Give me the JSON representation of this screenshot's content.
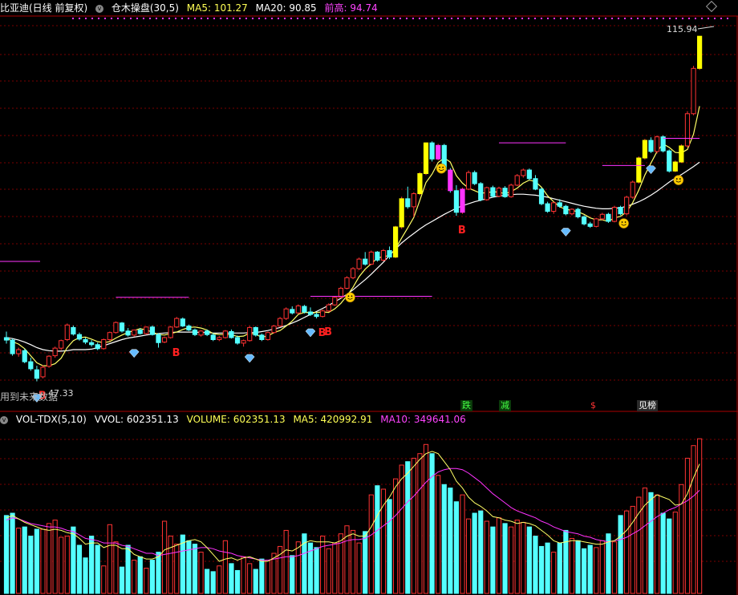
{
  "main_header": {
    "stock": "比亚迪(日线 前复权)",
    "indicator": "仓木操盘(30,5)",
    "ma5": "MA5: 101.27",
    "ma20": "MA20: 90.85",
    "prev_high": "前高: 94.74"
  },
  "vol_header": {
    "name": "VOL-TDX(5,10)",
    "vvol": "VVOL: 602351.13",
    "volume": "VOLUME: 602351.13",
    "ma5": "MA5: 420992.91",
    "ma10": "MA10: 349641.06"
  },
  "labels": {
    "max_price": "115.94",
    "min_price": "47.33",
    "future_note": "用到未来数据",
    "signals": [
      "跌",
      "减",
      "$",
      "见榜"
    ]
  },
  "colors": {
    "up": "#ff3333",
    "down": "#54ffff",
    "ma_short": "#ffff66",
    "ma_long": "#ffffff",
    "magenta": "#ff33ff",
    "grid": "#7a0000",
    "yellow_bar": "#ffff00",
    "buy_marker": "#ff2020",
    "diamond": "#66bbff",
    "smile": "#ffcc00",
    "header_white": "#ffffff",
    "header_yellow": "#ffff55",
    "header_magenta": "#ff44ff"
  },
  "chart_data": [
    {
      "type": "candlestick",
      "title": "比亚迪(日线 前复权)",
      "candles": [
        [
          56.0,
          57.2,
          54.8,
          55.5
        ],
        [
          55.5,
          55.8,
          52.4,
          52.8
        ],
        [
          52.8,
          54.0,
          52.2,
          53.6
        ],
        [
          53.4,
          53.8,
          50.9,
          51.2
        ],
        [
          51.2,
          52.0,
          49.4,
          49.8
        ],
        [
          49.6,
          50.4,
          47.3,
          47.9
        ],
        [
          48.2,
          50.5,
          47.9,
          50.1
        ],
        [
          50.3,
          52.5,
          50.0,
          52.3
        ],
        [
          52.4,
          54.2,
          52.0,
          53.9
        ],
        [
          53.9,
          55.6,
          53.5,
          55.4
        ],
        [
          55.6,
          58.8,
          55.3,
          58.5
        ],
        [
          58.0,
          58.4,
          56.4,
          56.7
        ],
        [
          56.6,
          57.0,
          55.4,
          55.7
        ],
        [
          55.6,
          56.0,
          54.7,
          55.1
        ],
        [
          55.0,
          55.5,
          54.2,
          54.6
        ],
        [
          54.6,
          55.0,
          53.5,
          53.8
        ],
        [
          53.8,
          55.8,
          53.6,
          55.6
        ],
        [
          55.6,
          57.2,
          55.3,
          57.0
        ],
        [
          57.0,
          59.2,
          56.8,
          59.0
        ],
        [
          58.9,
          59.1,
          57.0,
          57.3
        ],
        [
          57.3,
          57.9,
          56.2,
          56.5
        ],
        [
          56.5,
          57.6,
          56.2,
          57.5
        ],
        [
          57.5,
          57.9,
          56.6,
          56.8
        ],
        [
          56.8,
          58.2,
          56.6,
          58.1
        ],
        [
          58.1,
          58.4,
          56.4,
          56.6
        ],
        [
          56.6,
          56.9,
          54.0,
          55.0
        ],
        [
          55.1,
          56.2,
          54.9,
          56.0
        ],
        [
          56.0,
          58.3,
          55.8,
          58.1
        ],
        [
          58.1,
          60.1,
          57.9,
          59.8
        ],
        [
          59.7,
          60.0,
          58.1,
          58.3
        ],
        [
          58.3,
          58.6,
          57.3,
          57.5
        ],
        [
          57.5,
          57.8,
          56.3,
          56.6
        ],
        [
          56.5,
          57.5,
          56.2,
          57.3
        ],
        [
          57.3,
          57.6,
          56.3,
          56.6
        ],
        [
          56.5,
          56.9,
          55.3,
          55.6
        ],
        [
          55.6,
          56.3,
          55.3,
          56.0
        ],
        [
          56.0,
          57.5,
          55.8,
          57.3
        ],
        [
          57.2,
          57.6,
          55.8,
          56.0
        ],
        [
          56.0,
          56.4,
          54.6,
          54.9
        ],
        [
          54.9,
          55.6,
          54.2,
          55.4
        ],
        [
          55.4,
          58.3,
          55.2,
          58.0
        ],
        [
          58.0,
          58.2,
          56.2,
          56.5
        ],
        [
          56.5,
          56.8,
          55.3,
          55.6
        ],
        [
          55.6,
          57.2,
          55.4,
          57.0
        ],
        [
          57.0,
          58.5,
          56.8,
          58.3
        ],
        [
          58.3,
          60.1,
          58.1,
          59.8
        ],
        [
          59.8,
          62.0,
          59.5,
          61.7
        ],
        [
          61.6,
          62.2,
          60.6,
          60.9
        ],
        [
          60.9,
          62.6,
          60.7,
          62.3
        ],
        [
          62.2,
          62.5,
          60.8,
          61.1
        ],
        [
          61.1,
          62.0,
          60.3,
          60.6
        ],
        [
          60.6,
          61.0,
          59.8,
          60.2
        ],
        [
          60.2,
          61.6,
          60.0,
          61.3
        ],
        [
          61.3,
          62.8,
          61.1,
          62.5
        ],
        [
          62.5,
          64.2,
          62.3,
          64.0
        ],
        [
          64.0,
          66.1,
          63.8,
          65.8
        ],
        [
          65.8,
          68.2,
          65.6,
          67.9
        ],
        [
          67.9,
          70.0,
          67.6,
          69.7
        ],
        [
          69.7,
          71.9,
          69.4,
          71.6
        ],
        [
          71.6,
          73.0,
          70.3,
          70.6
        ],
        [
          70.6,
          73.3,
          70.4,
          73.0
        ],
        [
          73.0,
          73.2,
          71.1,
          71.4
        ],
        [
          71.4,
          73.6,
          71.2,
          73.3
        ],
        [
          73.3,
          74.1,
          71.6,
          72.0
        ],
        [
          72.0,
          78.2,
          71.8,
          78.0
        ],
        [
          78.0,
          84.0,
          77.6,
          83.6
        ],
        [
          83.6,
          86.0,
          81.6,
          82.0
        ],
        [
          82.0,
          84.9,
          80.0,
          84.6
        ],
        [
          84.6,
          88.9,
          84.3,
          88.6
        ],
        [
          88.6,
          94.8,
          88.3,
          94.7
        ],
        [
          94.7,
          95.0,
          91.0,
          91.5
        ],
        [
          91.5,
          94.5,
          91.2,
          94.2
        ],
        [
          94.2,
          94.5,
          88.8,
          89.3
        ],
        [
          89.3,
          89.7,
          84.8,
          85.2
        ],
        [
          85.2,
          86.3,
          80.2,
          80.9
        ],
        [
          80.9,
          85.8,
          80.6,
          85.5
        ],
        [
          85.5,
          89.2,
          85.3,
          88.8
        ],
        [
          88.8,
          89.2,
          86.3,
          86.6
        ],
        [
          86.6,
          86.9,
          83.1,
          83.4
        ],
        [
          83.4,
          86.0,
          83.2,
          85.8
        ],
        [
          85.8,
          86.2,
          83.8,
          84.1
        ],
        [
          84.1,
          86.0,
          83.9,
          85.7
        ],
        [
          85.7,
          86.1,
          83.8,
          84.0
        ],
        [
          84.0,
          86.6,
          83.8,
          86.3
        ],
        [
          86.3,
          88.5,
          86.1,
          88.2
        ],
        [
          88.2,
          89.6,
          87.8,
          89.3
        ],
        [
          89.3,
          89.6,
          87.3,
          87.6
        ],
        [
          87.6,
          88.3,
          85.3,
          85.5
        ],
        [
          85.5,
          85.8,
          82.3,
          82.6
        ],
        [
          82.6,
          83.0,
          80.8,
          81.1
        ],
        [
          81.1,
          83.0,
          80.6,
          82.8
        ],
        [
          82.8,
          83.5,
          81.8,
          82.1
        ],
        [
          82.1,
          82.4,
          80.3,
          80.6
        ],
        [
          80.6,
          81.7,
          80.3,
          81.5
        ],
        [
          81.5,
          81.8,
          79.7,
          80.0
        ],
        [
          80.0,
          80.3,
          78.3,
          78.6
        ],
        [
          78.6,
          79.0,
          77.8,
          78.1
        ],
        [
          78.1,
          79.8,
          77.9,
          79.6
        ],
        [
          79.6,
          80.8,
          79.3,
          80.5
        ],
        [
          80.5,
          80.8,
          78.8,
          79.1
        ],
        [
          79.1,
          82.2,
          78.9,
          81.9
        ],
        [
          81.9,
          82.2,
          80.3,
          80.6
        ],
        [
          80.6,
          84.2,
          80.3,
          83.9
        ],
        [
          83.9,
          87.2,
          83.6,
          86.9
        ],
        [
          86.9,
          92.0,
          86.6,
          91.7
        ],
        [
          91.7,
          95.5,
          91.4,
          95.2
        ],
        [
          95.2,
          95.8,
          92.7,
          93.0
        ],
        [
          93.0,
          96.2,
          92.6,
          95.9
        ],
        [
          95.9,
          96.2,
          92.8,
          93.1
        ],
        [
          93.1,
          93.4,
          88.8,
          89.1
        ],
        [
          89.1,
          91.2,
          88.9,
          90.9
        ],
        [
          90.9,
          94.4,
          90.7,
          94.1
        ],
        [
          94.1,
          101.0,
          93.8,
          100.5
        ],
        [
          100.5,
          110.0,
          100.2,
          109.5
        ],
        [
          109.5,
          115.94,
          109.2,
          115.9
        ]
      ],
      "ma5": [
        56.0,
        55.2,
        54.7,
        53.8,
        52.4,
        51.0,
        50.4,
        50.4,
        50.8,
        51.9,
        54.0,
        55.4,
        56.0,
        56.1,
        55.7,
        55.2,
        55.0,
        55.2,
        55.9,
        56.5,
        57.0,
        57.4,
        57.8,
        57.5,
        57.1,
        56.6,
        56.5,
        56.8,
        57.1,
        57.6,
        58.0,
        58.1,
        57.9,
        57.5,
        56.8,
        56.6,
        56.6,
        56.6,
        56.2,
        56.3,
        56.9,
        56.6,
        56.1,
        56.3,
        57.0,
        57.4,
        58.3,
        59.3,
        60.6,
        61.0,
        61.0,
        61.0,
        61.1,
        61.0,
        61.7,
        62.8,
        64.3,
        66.0,
        68.1,
        69.6,
        70.7,
        71.8,
        72.1,
        72.3,
        73.6,
        75.8,
        77.8,
        79.9,
        83.3,
        86.8,
        88.5,
        90.8,
        91.7,
        90.9,
        88.2,
        86.7,
        85.7,
        85.2,
        84.7,
        84.8,
        85.0,
        84.9,
        84.6,
        85.0,
        85.7,
        86.7,
        87.3,
        87.0,
        85.9,
        84.2,
        83.0,
        82.0,
        81.5,
        81.3,
        81.0,
        80.5,
        79.8,
        79.4,
        79.4,
        79.1,
        79.8,
        80.1,
        81.0,
        82.8,
        85.3,
        88.3,
        90.7,
        93.0,
        94.5,
        93.8,
        92.8,
        92.7,
        93.4,
        96.4,
        102.0
      ],
      "ma20": [
        56.0,
        55.8,
        55.5,
        55.1,
        54.6,
        54.0,
        53.6,
        53.4,
        53.3,
        53.3,
        53.4,
        53.6,
        53.6,
        53.6,
        53.7,
        54.0,
        54.4,
        54.8,
        55.2,
        55.6,
        55.9,
        56.1,
        56.3,
        56.5,
        56.7,
        56.8,
        56.9,
        57.0,
        57.1,
        57.1,
        57.1,
        57.1,
        57.0,
        57.0,
        56.9,
        56.9,
        56.9,
        56.9,
        56.9,
        56.9,
        57.0,
        57.0,
        57.2,
        57.4,
        57.7,
        58.0,
        58.4,
        58.9,
        59.4,
        60.0,
        60.6,
        61.2,
        61.8,
        62.4,
        63.1,
        63.8,
        64.6,
        65.5,
        66.5,
        67.5,
        68.6,
        69.8,
        71.0,
        72.3,
        73.6,
        74.8,
        75.8,
        76.7,
        77.6,
        78.4,
        79.1,
        79.8,
        80.5,
        81.1,
        81.7,
        82.2,
        82.6,
        83.0,
        83.3,
        83.6,
        83.9,
        84.1,
        84.3,
        84.4,
        84.5,
        84.5,
        84.4,
        84.3,
        84.1,
        83.9,
        83.6,
        83.3,
        83.0,
        82.7,
        82.4,
        82.1,
        81.9,
        81.7,
        81.6,
        81.6,
        81.7,
        81.8,
        82.1,
        82.5,
        83.0,
        83.6,
        84.3,
        85.1,
        86.0,
        86.9,
        87.7,
        88.4,
        89.2,
        90.0,
        90.85
      ],
      "resistance_segments": [
        {
          "from": 18,
          "to": 30,
          "price": 64.0
        },
        {
          "from": 50,
          "to": 70,
          "price": 64.2
        },
        {
          "from": 81,
          "to": 92,
          "price": 94.7
        },
        {
          "from": 98,
          "to": 105,
          "price": 90.2
        },
        {
          "from": 108,
          "to": 114,
          "price": 95.6
        }
      ],
      "yellow_bars": [
        64,
        65,
        68,
        69,
        104,
        105,
        110,
        111,
        114
      ],
      "magenta_bars": [
        71,
        73,
        75
      ],
      "buy_signals": [
        5,
        27,
        51,
        52,
        74
      ],
      "diamond_signals": [
        5,
        21,
        40,
        50,
        92,
        106
      ],
      "smile_signals": [
        56,
        71,
        101,
        110
      ],
      "last_ma5": 101.27,
      "last_ma20": 90.85,
      "prev_high": 94.74,
      "max_price": 115.94,
      "min_price": 47.33
    },
    {
      "type": "bar",
      "title": "VOL-TDX(5,10)",
      "volumes": [
        68,
        70,
        57,
        58,
        50,
        56,
        56,
        61,
        64,
        49,
        50,
        58,
        42,
        31,
        50,
        42,
        24,
        60,
        45,
        23,
        42,
        29,
        32,
        22,
        29,
        36,
        63,
        50,
        43,
        51,
        46,
        43,
        36,
        21,
        19,
        24,
        46,
        26,
        20,
        32,
        26,
        21,
        30,
        29,
        35,
        41,
        55,
        33,
        45,
        52,
        44,
        40,
        50,
        39,
        44,
        52,
        59,
        55,
        44,
        54,
        86,
        94,
        91,
        82,
        100,
        112,
        115,
        118,
        122,
        130,
        122,
        103,
        95,
        92,
        80,
        86,
        65,
        70,
        72,
        63,
        58,
        66,
        61,
        58,
        64,
        62,
        58,
        50,
        41,
        44,
        36,
        44,
        55,
        48,
        46,
        39,
        42,
        40,
        46,
        52,
        45,
        68,
        72,
        76,
        84,
        92,
        88,
        86,
        70,
        65,
        71,
        95,
        118,
        129,
        135
      ],
      "ma5": [
        66,
        68,
        65,
        62,
        60,
        58,
        56,
        55,
        56,
        55,
        53,
        52,
        48,
        43,
        44,
        44,
        40,
        42,
        42,
        39,
        39,
        34,
        32,
        30,
        30,
        32,
        38,
        40,
        42,
        44,
        46,
        47,
        45,
        40,
        34,
        28,
        30,
        31,
        29,
        31,
        32,
        30,
        28,
        28,
        31,
        34,
        38,
        37,
        40,
        44,
        46,
        45,
        45,
        45,
        44,
        46,
        50,
        52,
        50,
        50,
        58,
        68,
        77,
        84,
        93,
        100,
        105,
        111,
        117,
        122,
        124,
        122,
        115,
        108,
        98,
        92,
        84,
        79,
        76,
        72,
        67,
        66,
        64,
        63,
        61,
        62,
        61,
        59,
        55,
        51,
        46,
        44,
        45,
        46,
        46,
        45,
        44,
        43,
        43,
        45,
        46,
        50,
        55,
        62,
        70,
        77,
        82,
        86,
        84,
        82,
        77,
        78,
        87,
        101,
        113
      ],
      "ma10": [
        64,
        66,
        65,
        63,
        61,
        60,
        59,
        58,
        58,
        57,
        55,
        54,
        51,
        48,
        47,
        46,
        44,
        44,
        44,
        42,
        41,
        39,
        37,
        35,
        35,
        33,
        34,
        35,
        36,
        37,
        38,
        39,
        40,
        40,
        39,
        37,
        36,
        35,
        33,
        32,
        31,
        30,
        29,
        29,
        30,
        31,
        32,
        32,
        33,
        35,
        37,
        39,
        41,
        42,
        43,
        44,
        46,
        47,
        47,
        48,
        51,
        55,
        59,
        63,
        68,
        74,
        80,
        85,
        91,
        97,
        102,
        106,
        108,
        109,
        109,
        108,
        105,
        101,
        97,
        92,
        87,
        83,
        79,
        75,
        72,
        70,
        68,
        66,
        63,
        61,
        58,
        56,
        54,
        53,
        52,
        50,
        49,
        47,
        46,
        45,
        46,
        47,
        49,
        52,
        55,
        59,
        63,
        67,
        70,
        73,
        75,
        78,
        81,
        85,
        90
      ],
      "last_volume": 602351.13,
      "last_ma5": 420992.91,
      "last_ma10": 349641.06
    }
  ]
}
